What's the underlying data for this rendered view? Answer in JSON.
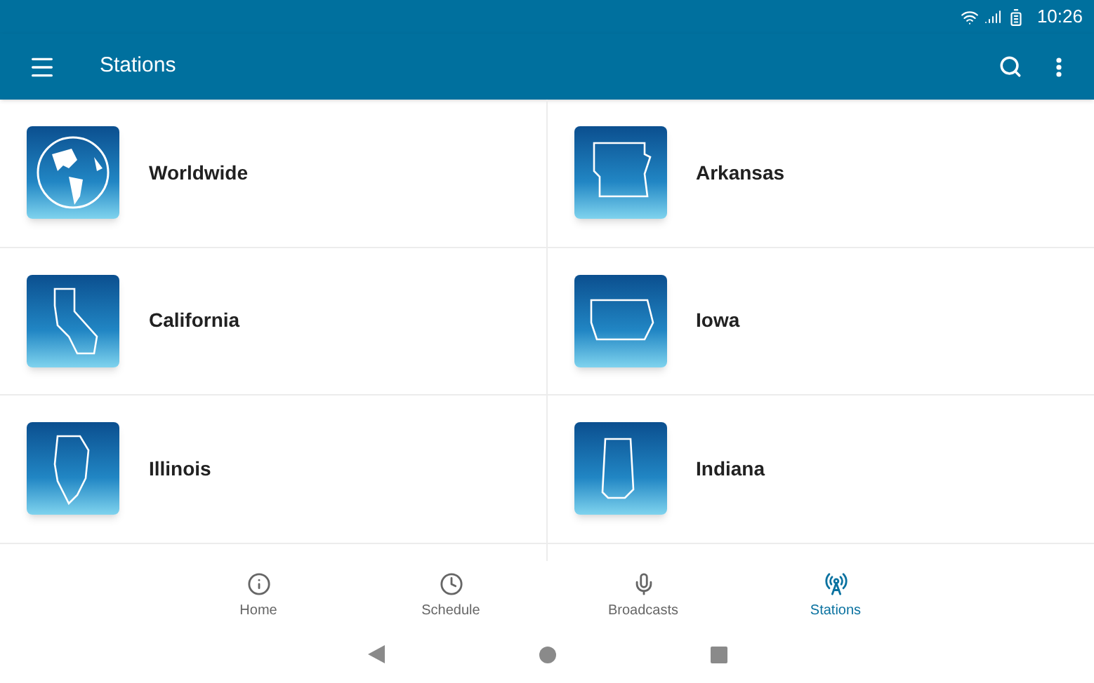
{
  "status_bar": {
    "time": "10:26"
  },
  "toolbar": {
    "title": "Stations"
  },
  "stations": [
    {
      "name": "Worldwide"
    },
    {
      "name": "Arkansas"
    },
    {
      "name": "California"
    },
    {
      "name": "Iowa"
    },
    {
      "name": "Illinois"
    },
    {
      "name": "Indiana"
    }
  ],
  "bottom_nav": [
    {
      "label": "Home",
      "selected": false
    },
    {
      "label": "Schedule",
      "selected": false
    },
    {
      "label": "Broadcasts",
      "selected": false
    },
    {
      "label": "Stations",
      "selected": true
    }
  ]
}
